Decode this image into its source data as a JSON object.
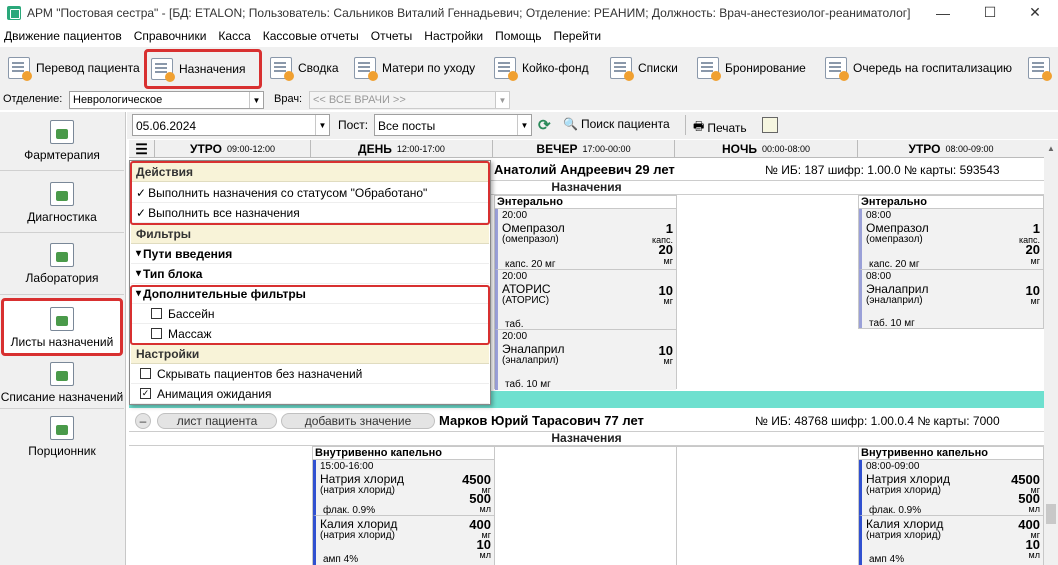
{
  "window": {
    "title": "АРМ \"Постовая сестра\" - [БД: ETALON; Пользователь: Сальников Виталий Геннадьевич; Отделение: РЕАНИМ; Должность: Врач-анестезиолог-реаниматолог]",
    "minimize": "—",
    "maximize": "☐",
    "close": "✕"
  },
  "menu": [
    "Движение пациентов",
    "Справочники",
    "Касса",
    "Кассовые отчеты",
    "Отчеты",
    "Настройки",
    "Помощь",
    "Перейти"
  ],
  "toolbar": {
    "items": [
      {
        "label": "Перевод пациента",
        "icon": "transfer-icon"
      },
      {
        "label": "Назначения",
        "icon": "prescriptions-icon",
        "selected": true
      },
      {
        "label": "Сводка",
        "icon": "summary-icon"
      },
      {
        "label": "Матери по уходу",
        "icon": "mothers-icon"
      },
      {
        "label": "Койко-фонд",
        "icon": "bed-fund-icon"
      },
      {
        "label": "Списки",
        "icon": "lists-icon"
      },
      {
        "label": "Бронирование",
        "icon": "booking-icon"
      },
      {
        "label": "Очередь на госпитализацию",
        "icon": "queue-icon"
      }
    ]
  },
  "filters": {
    "department_label": "Отделение:",
    "department_value": "Неврологическое",
    "doctor_label": "Врач:",
    "doctor_value": "<< ВСЕ ВРАЧИ >>"
  },
  "sidebar": {
    "items": [
      {
        "label": "Фармтерапия",
        "icon": "pharmacotherapy-icon"
      },
      {
        "label": "Диагностика",
        "icon": "diagnostics-icon"
      },
      {
        "label": "Лаборатория",
        "icon": "laboratory-icon"
      },
      {
        "label": "Листы назначений",
        "icon": "prescription-sheets-icon",
        "selected": true
      },
      {
        "label": "Списание назначений",
        "icon": "write-off-icon"
      },
      {
        "label": "Порционник",
        "icon": "portion-icon"
      }
    ]
  },
  "controls": {
    "date": "05.06.2024",
    "post_label": "Пост:",
    "post_value": "Все посты",
    "search_label": "Поиск пациента",
    "print_label": "Печать"
  },
  "timeline": [
    {
      "name": "УТРО",
      "range": "09:00-12:00"
    },
    {
      "name": "ДЕНЬ",
      "range": "12:00-17:00"
    },
    {
      "name": "ВЕЧЕР",
      "range": "17:00-00:00"
    },
    {
      "name": "НОЧЬ",
      "range": "00:00-08:00"
    },
    {
      "name": "УТРО",
      "range": "08:00-09:00"
    }
  ],
  "menu_dropdown": {
    "actions_header": "Действия",
    "action1": "Выполнить назначения со статусом \"Обработано\"",
    "action2": "Выполнить все назначения",
    "filters_header": "Фильтры",
    "routes": "Пути введения",
    "block_type": "Тип блока",
    "extra_filters": "Дополнительные фильтры",
    "pool": "Бассейн",
    "massage": "Массаж",
    "settings_header": "Настройки",
    "hide_patients": "Скрывать пациентов без назначений",
    "animation": "Анимация ожидания",
    "check_mark": "✓",
    "tri": "▾"
  },
  "patient1": {
    "name": "Анатолий Андреевич 29 лет",
    "info": "№ ИБ: 187 шифр: 1.00.0 № карты: 593543",
    "section": "Назначения",
    "route_evening": "Энтерально",
    "route_morning": "Энтерально",
    "evening_cards": [
      {
        "time": "20:00",
        "name": "Омепразол",
        "sub": "(омепразол)",
        "qty": "1",
        "unit": "капс.",
        "qty2": "20",
        "unit2": "мг",
        "footer": "капс. 20 мг"
      },
      {
        "time": "20:00",
        "name": "АТОРИС",
        "sub": "(АТОРИС)",
        "qty": "10",
        "unit": "мг",
        "footer": "таб."
      },
      {
        "time": "20:00",
        "name": "Эналаприл",
        "sub": "(эналаприл)",
        "qty": "10",
        "unit": "мг",
        "footer": "таб. 10 мг"
      }
    ],
    "morning_cards": [
      {
        "time": "08:00",
        "name": "Омепразол",
        "sub": "(омепразол)",
        "qty": "1",
        "unit": "капс.",
        "qty2": "20",
        "unit2": "мг",
        "footer": "капс. 20 мг"
      },
      {
        "time": "08:00",
        "name": "Эналаприл",
        "sub": "(эналаприл)",
        "qty": "10",
        "unit": "мг",
        "footer": "таб. 10 мг"
      }
    ]
  },
  "patient2": {
    "collapse": "–",
    "sheet_btn": "лист пациента",
    "add_btn": "добавить значение",
    "name": "Марков Юрий Тарасович 77 лет",
    "info": "№ ИБ: 48768 шифр: 1.00.0.4 № карты: 7000",
    "section": "Назначения",
    "route_day": "Внутривенно капельно",
    "route_morning": "Внутривенно капельно",
    "day_cards": [
      {
        "time": "15:00-16:00",
        "name": "Натрия хлорид",
        "sub": "(натрия хлорид)",
        "qty": "4500",
        "unit": "мг",
        "qty2": "500",
        "unit2": "мл",
        "footer": "флак. 0.9%"
      },
      {
        "time": "",
        "name": "Калия хлорид",
        "sub": "(натрия хлорид)",
        "qty": "400",
        "unit": "мг",
        "qty2": "10",
        "unit2": "мл",
        "footer": "амп 4%"
      }
    ],
    "morning_cards": [
      {
        "time": "08:00-09:00",
        "name": "Натрия хлорид",
        "sub": "(натрия хлорид)",
        "qty": "4500",
        "unit": "мг",
        "qty2": "500",
        "unit2": "мл",
        "footer": "флак. 0.9%"
      },
      {
        "time": "",
        "name": "Калия хлорид",
        "sub": "(натрия хлорид)",
        "qty": "400",
        "unit": "мг",
        "qty2": "10",
        "unit2": "мл",
        "footer": "амп 4%"
      }
    ]
  },
  "colors": {
    "highlight": "#d83030",
    "teal_separator": "#6ee0cf",
    "section_bg": "#f8f3d8"
  }
}
